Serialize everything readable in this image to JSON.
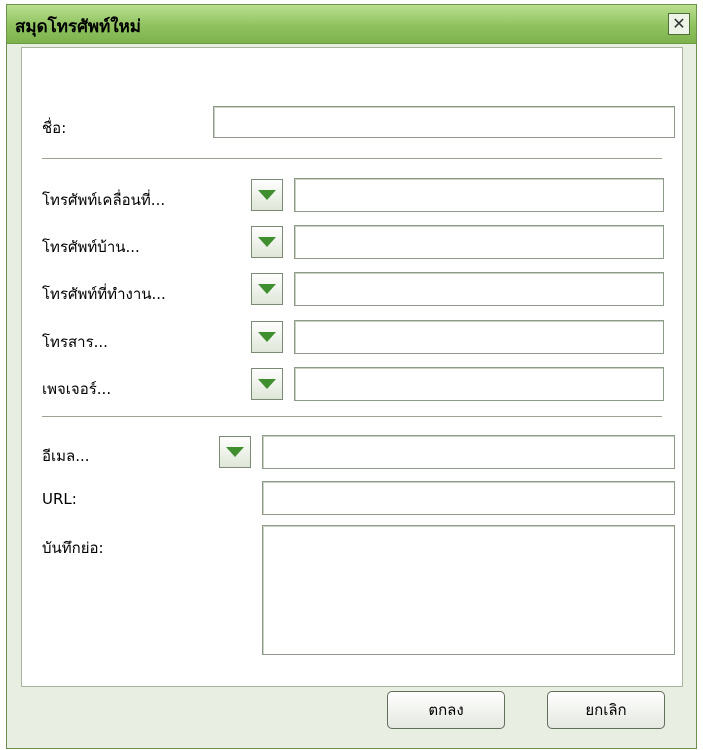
{
  "window": {
    "title": "สมุดโทรศัพท์ใหม่",
    "close_symbol": "✕"
  },
  "form": {
    "name_label": "ชื่อ:",
    "name_value": "",
    "phones": [
      {
        "label": "โทรศัพท์เคลื่อนที่...",
        "value": ""
      },
      {
        "label": "โทรศัพท์บ้าน...",
        "value": ""
      },
      {
        "label": "โทรศัพท์ที่ทำงาน...",
        "value": ""
      },
      {
        "label": "โทรสาร...",
        "value": ""
      },
      {
        "label": "เพจเจอร์...",
        "value": ""
      }
    ],
    "email_label": "อีเมล...",
    "email_value": "",
    "url_label": "URL:",
    "url_value": "",
    "notes_label": "บันทึกย่อ:",
    "notes_value": ""
  },
  "buttons": {
    "ok_label": "ตกลง",
    "cancel_label": "ยกเลิก"
  },
  "icons": {
    "dropdown": "triangle-down-icon",
    "close": "close-icon"
  },
  "colors": {
    "titlebar": "#8fc25f",
    "dropdown_arrow": "#3f8f2f"
  }
}
